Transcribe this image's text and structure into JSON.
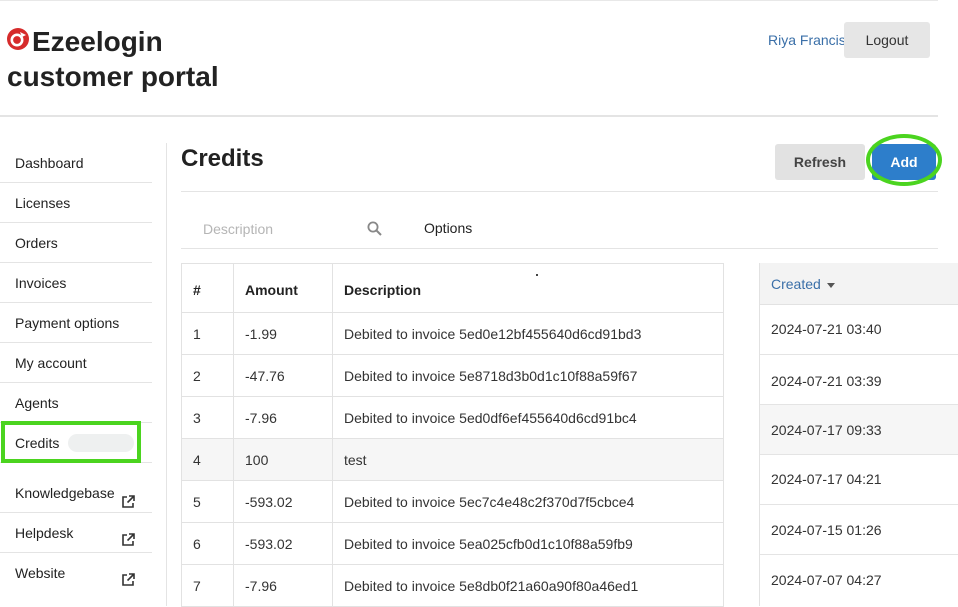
{
  "brand": {
    "name": "Ezeelogin",
    "subtitle": "customer portal",
    "accent": "#d62b2b"
  },
  "header": {
    "user_name": "Riya Francis",
    "logout_label": "Logout"
  },
  "sidebar": {
    "items": [
      {
        "label": "Dashboard"
      },
      {
        "label": "Licenses"
      },
      {
        "label": "Orders"
      },
      {
        "label": "Invoices"
      },
      {
        "label": "Payment options"
      },
      {
        "label": "My account"
      },
      {
        "label": "Agents"
      },
      {
        "label": "Credits",
        "active": true
      },
      {
        "label": "Knowledgebase",
        "icon": "external-link-icon"
      },
      {
        "label": "Helpdesk",
        "icon": "external-link-icon"
      },
      {
        "label": "Website",
        "icon": "external-link-icon"
      }
    ]
  },
  "main": {
    "title": "Credits",
    "refresh_label": "Refresh",
    "add_label": "Add",
    "search": {
      "placeholder": "Description",
      "value": ""
    },
    "options_label": "Options",
    "table": {
      "headers": {
        "num": "#",
        "amount": "Amount",
        "description": "Description",
        "created": "Created"
      },
      "sort": {
        "column": "created",
        "direction": "desc",
        "icon": "caret-down-icon"
      },
      "rows": [
        {
          "num": "1",
          "amount": "-1.99",
          "description": "Debited to invoice 5ed0e12bf455640d6cd91bd3"
        },
        {
          "num": "2",
          "amount": "-47.76",
          "description": "Debited to invoice 5e8718d3b0d1c10f88a59f67"
        },
        {
          "num": "3",
          "amount": "-7.96",
          "description": "Debited to invoice 5ed0df6ef455640d6cd91bc4"
        },
        {
          "num": "4",
          "amount": "100",
          "description": "test"
        },
        {
          "num": "5",
          "amount": "-593.02",
          "description": "Debited to invoice 5ec7c4e48c2f370d7f5cbce4"
        },
        {
          "num": "6",
          "amount": "-593.02",
          "description": "Debited to invoice 5ea025cfb0d1c10f88a59fb9"
        },
        {
          "num": "7",
          "amount": "-7.96",
          "description": "Debited to invoice 5e8db0f21a60a90f80a46ed1"
        }
      ],
      "created": [
        "2024-07-21 03:40",
        "2024-07-21 03:39",
        "2024-07-17 09:33",
        "2024-07-17 04:21",
        "2024-07-15 01:26",
        "2024-07-07 04:27"
      ]
    }
  },
  "colors": {
    "primary": "#2d7ecb",
    "highlight": "#4bd41f",
    "link": "#3a6fa8"
  }
}
